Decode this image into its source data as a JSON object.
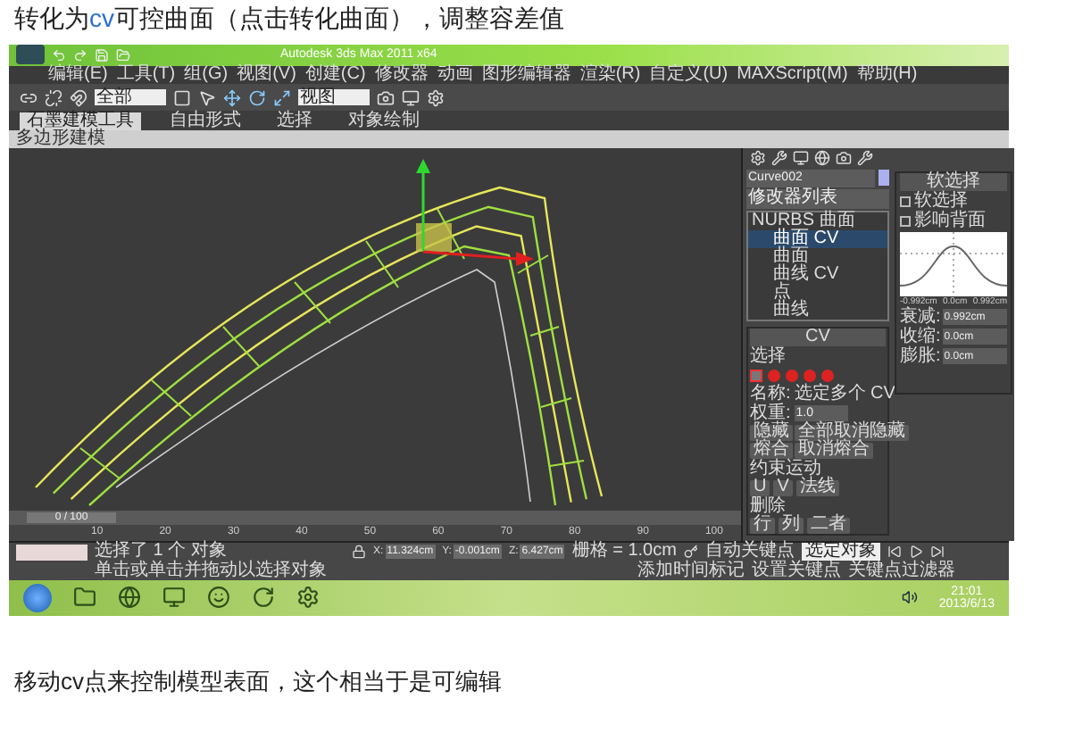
{
  "heading": [
    {
      "text": "转化为",
      "kind": "plain"
    },
    {
      "text": "cv",
      "kind": "accent"
    },
    {
      "text": "可控曲面（点击转化曲面），调整容差值",
      "kind": "plain"
    }
  ],
  "app": {
    "title": "Autodesk 3ds Max 2011 x64",
    "menus": [
      "编辑(E)",
      "工具(T)",
      "组(G)",
      "视图(V)",
      "创建(C)",
      "修改器",
      "动画",
      "图形编辑器",
      "渲染(R)",
      "自定义(U)",
      "MAXScript(M)",
      "帮助(H)"
    ],
    "toolbar": {
      "selection_filter": "全部",
      "reference_coord": "视图"
    },
    "ribbon_tabs": [
      {
        "label": "石墨建模工具",
        "selected": true
      },
      {
        "label": "自由形式",
        "selected": false
      },
      {
        "label": "选择",
        "selected": false
      },
      {
        "label": "对象绘制",
        "selected": false
      }
    ],
    "ribbon_panel": "多边形建模",
    "command_panel": {
      "object_name": "Curve002",
      "modifier_list": "修改器列表",
      "stack": [
        {
          "label": "NURBS 曲面",
          "selected": false,
          "children": [
            {
              "label": "曲面 CV",
              "selected": true
            },
            {
              "label": "曲面",
              "selected": false
            },
            {
              "label": "曲线 CV",
              "selected": false
            },
            {
              "label": "点",
              "selected": false
            },
            {
              "label": "曲线",
              "selected": false
            }
          ]
        }
      ],
      "cv_rollout": {
        "title": "CV",
        "selection_group": "选择",
        "name_label": "名称:",
        "name_value": "选定多个 CV",
        "weight_label": "权重:",
        "weight_value": "1.0",
        "buttons": [
          [
            "隐藏",
            "全部取消隐藏"
          ],
          [
            "熔合",
            "取消熔合"
          ]
        ],
        "constrain_group": "约束运动",
        "constrain_buttons": [
          "U",
          "V",
          "法线"
        ],
        "delete_group": "删除",
        "delete_buttons": [
          "行",
          "列",
          "二者"
        ]
      },
      "soft_selection": {
        "title": "软选择",
        "options": [
          {
            "label": "软选择",
            "checked": false
          },
          {
            "label": "影响背面",
            "checked": false
          }
        ],
        "graph_labels": [
          "-0.992cm",
          "0.0cm",
          "0.992cm"
        ],
        "fields": [
          {
            "label": "衰减:",
            "value": "0.992cm"
          },
          {
            "label": "收缩:",
            "value": "0.0cm"
          },
          {
            "label": "膨胀:",
            "value": "0.0cm"
          }
        ]
      }
    },
    "timeline": {
      "frame": "0 / 100",
      "level": 0,
      "ticks": [
        "10",
        "20",
        "30",
        "40",
        "50",
        "60",
        "70",
        "80",
        "90",
        "100"
      ]
    },
    "status": {
      "selection": "选择了 1 个 对象",
      "prompt": "单击或单击并拖动以选择对象",
      "coords": [
        {
          "axis": "X:",
          "value": "11.324cm"
        },
        {
          "axis": "Y:",
          "value": "-0.001cm"
        },
        {
          "axis": "Z:",
          "value": "6.427cm"
        }
      ],
      "grid": "栅格 = 1.0cm",
      "add_time_tag": "添加时间标记",
      "auto_key": "自动关键点",
      "key_mode": "选定对象",
      "set_key": "设置关键点",
      "key_filters": "关键点过滤器"
    },
    "taskbar": {
      "time": "21:01",
      "date": "2013/6/13"
    }
  },
  "caption": "移动cv点来控制模型表面，这个相当于是可编辑"
}
